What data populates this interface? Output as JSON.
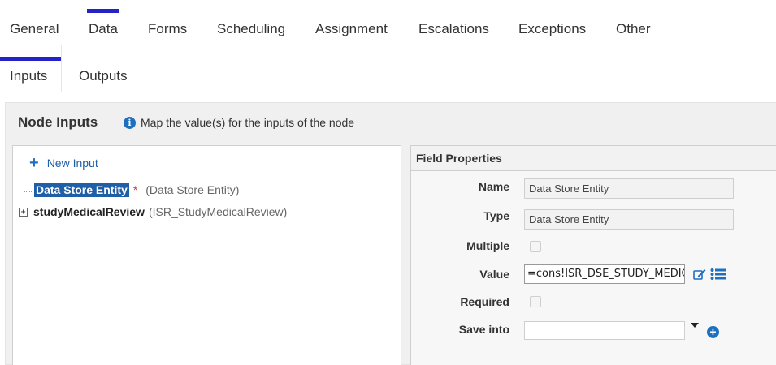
{
  "main_tabs": [
    {
      "label": "General"
    },
    {
      "label": "Data"
    },
    {
      "label": "Forms"
    },
    {
      "label": "Scheduling"
    },
    {
      "label": "Assignment"
    },
    {
      "label": "Escalations"
    },
    {
      "label": "Exceptions"
    },
    {
      "label": "Other"
    }
  ],
  "active_main_tab": "Data",
  "sub_tabs": [
    {
      "label": "Inputs"
    },
    {
      "label": "Outputs"
    }
  ],
  "active_sub_tab": "Inputs",
  "panel": {
    "title": "Node Inputs",
    "hint": "Map the value(s) for the inputs of the node",
    "info_icon": "i"
  },
  "tree": {
    "new_input_label": "New Input",
    "plus_icon": "+",
    "nodes": [
      {
        "name": "Data Store Entity",
        "required_mark": "*",
        "type": "(Data Store Entity)",
        "selected": true
      },
      {
        "name": "studyMedicalReview",
        "type": "(ISR_StudyMedicalReview)",
        "expander": "+"
      }
    ]
  },
  "field_properties": {
    "header": "Field Properties",
    "name_label": "Name",
    "name_value": "Data Store Entity",
    "type_label": "Type",
    "type_value": "Data Store Entity",
    "multiple_label": "Multiple",
    "value_label": "Value",
    "value_value": "=cons!ISR_DSE_STUDY_MEDICA",
    "required_label": "Required",
    "save_into_label": "Save into",
    "save_into_value": "",
    "add_icon": "+"
  },
  "colors": {
    "accent": "#2323c8",
    "link": "#1f5fa8",
    "icon_blue": "#1f6fbf",
    "required": "#dd3333"
  }
}
